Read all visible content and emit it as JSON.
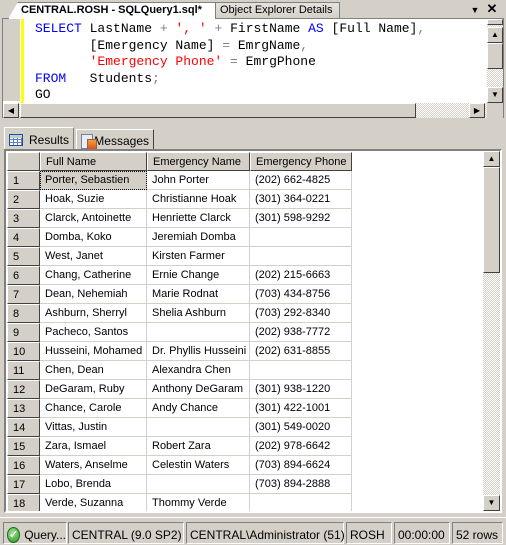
{
  "tabs": [
    {
      "label": "CENTRAL.ROSH - SQLQuery1.sql*",
      "active": true
    },
    {
      "label": "Object Explorer Details",
      "active": false
    }
  ],
  "tab_controls": {
    "menu_icon": "▼",
    "close_icon": "✕"
  },
  "editor": {
    "lines": [
      [
        {
          "t": "SELECT",
          "c": "kw"
        },
        {
          "t": " LastName "
        },
        {
          "t": "+",
          "c": "op"
        },
        {
          "t": " "
        },
        {
          "t": "', '",
          "c": "str"
        },
        {
          "t": " "
        },
        {
          "t": "+",
          "c": "op"
        },
        {
          "t": " FirstName "
        },
        {
          "t": "AS",
          "c": "kw"
        },
        {
          "t": " [Full Name]"
        },
        {
          "t": ",",
          "c": "op"
        }
      ],
      [
        {
          "t": "       [Emergency Name] "
        },
        {
          "t": "=",
          "c": "op"
        },
        {
          "t": " EmrgName"
        },
        {
          "t": ",",
          "c": "op"
        }
      ],
      [
        {
          "t": "       "
        },
        {
          "t": "'Emergency Phone'",
          "c": "str"
        },
        {
          "t": " "
        },
        {
          "t": "=",
          "c": "op"
        },
        {
          "t": " EmrgPhone"
        }
      ],
      [
        {
          "t": "FROM",
          "c": "kw"
        },
        {
          "t": "   Students"
        },
        {
          "t": ";",
          "c": "op"
        }
      ],
      [
        {
          "t": "GO"
        }
      ]
    ]
  },
  "results_tabs": [
    {
      "label": "Results",
      "icon": "grid-icon",
      "active": true
    },
    {
      "label": "Messages",
      "icon": "messages-icon",
      "active": false
    }
  ],
  "grid": {
    "columns": [
      "Full Name",
      "Emergency Name",
      "Emergency Phone"
    ],
    "rows": [
      [
        "1",
        "Porter, Sebastien",
        "John Porter",
        "(202) 662-4825"
      ],
      [
        "2",
        "Hoak, Suzie",
        "Christianne Hoak",
        "(301) 364-0221"
      ],
      [
        "3",
        "Clarck, Antoinette",
        "Henriette Clarck",
        "(301) 598-9292"
      ],
      [
        "4",
        "Domba, Koko",
        "Jeremiah Domba",
        ""
      ],
      [
        "5",
        "West, Janet",
        "Kirsten Farmer",
        ""
      ],
      [
        "6",
        "Chang, Catherine",
        "Ernie Change",
        "(202) 215-6663"
      ],
      [
        "7",
        "Dean, Nehemiah",
        "Marie Rodnat",
        "(703) 434-8756"
      ],
      [
        "8",
        "Ashburn, Sherryl",
        "Shelia Ashburn",
        "(703) 292-8340"
      ],
      [
        "9",
        "Pacheco, Santos",
        "",
        "(202) 938-7772"
      ],
      [
        "10",
        "Husseini, Mohamed",
        "Dr. Phyllis Husseini",
        "(202) 631-8855"
      ],
      [
        "11",
        "Chen, Dean",
        "Alexandra Chen",
        ""
      ],
      [
        "12",
        "DeGaram, Ruby",
        "Anthony DeGaram",
        "(301) 938-1220"
      ],
      [
        "13",
        "Chance, Carole",
        "Andy Chance",
        "(301) 422-1001"
      ],
      [
        "14",
        "Vittas, Justin",
        "",
        "(301) 549-0020"
      ],
      [
        "15",
        "Zara, Ismael",
        "Robert Zara",
        "(202) 978-6642"
      ],
      [
        "16",
        "Waters, Anselme",
        "Celestin Waters",
        "(703) 894-6624"
      ],
      [
        "17",
        "Lobo, Brenda",
        "",
        "(703) 894-2888"
      ],
      [
        "18",
        "Verde, Suzanna",
        "Thommy Verde",
        ""
      ]
    ],
    "selected_cell": {
      "row": 0,
      "col": 1
    }
  },
  "status_bar": {
    "query_status": "Query...",
    "server": "CENTRAL (9.0 SP2)",
    "user": "CENTRAL\\Administrator (51)",
    "database": "ROSH",
    "elapsed": "00:00:00",
    "row_count": "52 rows"
  }
}
